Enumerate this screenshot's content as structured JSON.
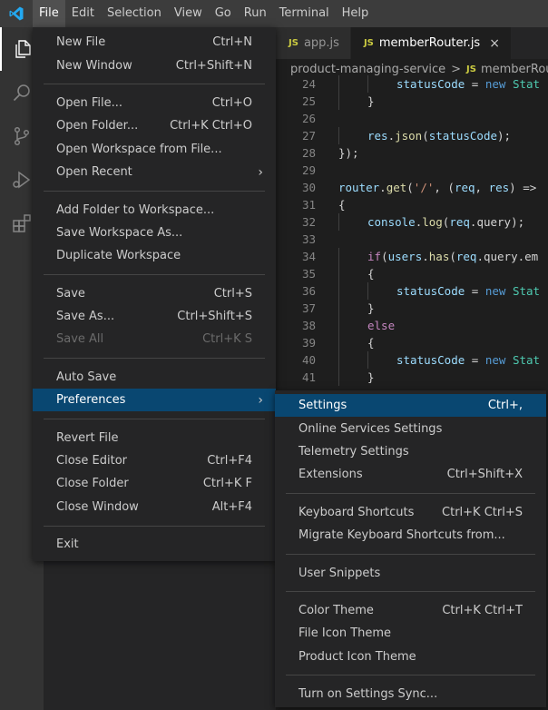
{
  "menubar": {
    "items": [
      "File",
      "Edit",
      "Selection",
      "View",
      "Go",
      "Run",
      "Terminal",
      "Help"
    ],
    "active_index": 0
  },
  "colors": {
    "accent": "#094771",
    "menu_bg": "#252526",
    "activity_bar": "#333333",
    "logo": "#23a9f2"
  },
  "tabs": [
    {
      "label": "app.js",
      "badge": "JS",
      "active": false
    },
    {
      "label": "memberRouter.js",
      "badge": "JS",
      "active": true,
      "close": "×"
    }
  ],
  "breadcrumb": {
    "folder": "product-managing-service",
    "separator": ">",
    "badge": "JS",
    "file": "memberRouter."
  },
  "code": {
    "lines": [
      {
        "n": "24",
        "indent": 2,
        "text": "statusCode = new Stat"
      },
      {
        "n": "25",
        "indent": 1,
        "text": "}"
      },
      {
        "n": "26",
        "indent": 0,
        "text": ""
      },
      {
        "n": "27",
        "indent": 1,
        "text": "res.json(statusCode);"
      },
      {
        "n": "28",
        "indent": 0,
        "text": "});"
      },
      {
        "n": "29",
        "indent": 0,
        "text": ""
      },
      {
        "n": "30",
        "indent": 0,
        "text": "router.get('/', (req, res) =>"
      },
      {
        "n": "31",
        "indent": 0,
        "text": "{"
      },
      {
        "n": "32",
        "indent": 1,
        "text": "console.log(req.query);"
      },
      {
        "n": "33",
        "indent": 0,
        "text": ""
      },
      {
        "n": "34",
        "indent": 1,
        "text": "if(users.has(req.query.em"
      },
      {
        "n": "35",
        "indent": 1,
        "text": "{"
      },
      {
        "n": "36",
        "indent": 2,
        "text": "statusCode = new Stat"
      },
      {
        "n": "37",
        "indent": 1,
        "text": "}"
      },
      {
        "n": "38",
        "indent": 1,
        "text": "else"
      },
      {
        "n": "39",
        "indent": 1,
        "text": "{"
      },
      {
        "n": "40",
        "indent": 2,
        "text": "statusCode = new Stat"
      },
      {
        "n": "41",
        "indent": 1,
        "text": "}"
      }
    ]
  },
  "file_menu": {
    "groups": [
      [
        {
          "label": "New File",
          "key": "Ctrl+N"
        },
        {
          "label": "New Window",
          "key": "Ctrl+Shift+N"
        }
      ],
      [
        {
          "label": "Open File...",
          "key": "Ctrl+O"
        },
        {
          "label": "Open Folder...",
          "key": "Ctrl+K Ctrl+O"
        },
        {
          "label": "Open Workspace from File...",
          "key": ""
        },
        {
          "label": "Open Recent",
          "key": "",
          "submenu": true
        }
      ],
      [
        {
          "label": "Add Folder to Workspace...",
          "key": ""
        },
        {
          "label": "Save Workspace As...",
          "key": ""
        },
        {
          "label": "Duplicate Workspace",
          "key": ""
        }
      ],
      [
        {
          "label": "Save",
          "key": "Ctrl+S"
        },
        {
          "label": "Save As...",
          "key": "Ctrl+Shift+S"
        },
        {
          "label": "Save All",
          "key": "Ctrl+K S",
          "disabled": true
        }
      ],
      [
        {
          "label": "Auto Save",
          "key": ""
        },
        {
          "label": "Preferences",
          "key": "",
          "submenu": true,
          "selected": true
        }
      ],
      [
        {
          "label": "Revert File",
          "key": ""
        },
        {
          "label": "Close Editor",
          "key": "Ctrl+F4"
        },
        {
          "label": "Close Folder",
          "key": "Ctrl+K F"
        },
        {
          "label": "Close Window",
          "key": "Alt+F4"
        }
      ],
      [
        {
          "label": "Exit",
          "key": ""
        }
      ]
    ]
  },
  "preferences_menu": {
    "groups": [
      [
        {
          "label": "Settings",
          "key": "Ctrl+,",
          "selected": true
        },
        {
          "label": "Online Services Settings",
          "key": ""
        },
        {
          "label": "Telemetry Settings",
          "key": ""
        },
        {
          "label": "Extensions",
          "key": "Ctrl+Shift+X"
        }
      ],
      [
        {
          "label": "Keyboard Shortcuts",
          "key": "Ctrl+K Ctrl+S"
        },
        {
          "label": "Migrate Keyboard Shortcuts from...",
          "key": ""
        }
      ],
      [
        {
          "label": "User Snippets",
          "key": ""
        }
      ],
      [
        {
          "label": "Color Theme",
          "key": "Ctrl+K Ctrl+T"
        },
        {
          "label": "File Icon Theme",
          "key": ""
        },
        {
          "label": "Product Icon Theme",
          "key": ""
        }
      ],
      [
        {
          "label": "Turn on Settings Sync...",
          "key": ""
        }
      ]
    ]
  },
  "activity_icons": [
    "explorer-icon",
    "search-icon",
    "source-control-icon",
    "run-debug-icon",
    "extensions-icon"
  ]
}
